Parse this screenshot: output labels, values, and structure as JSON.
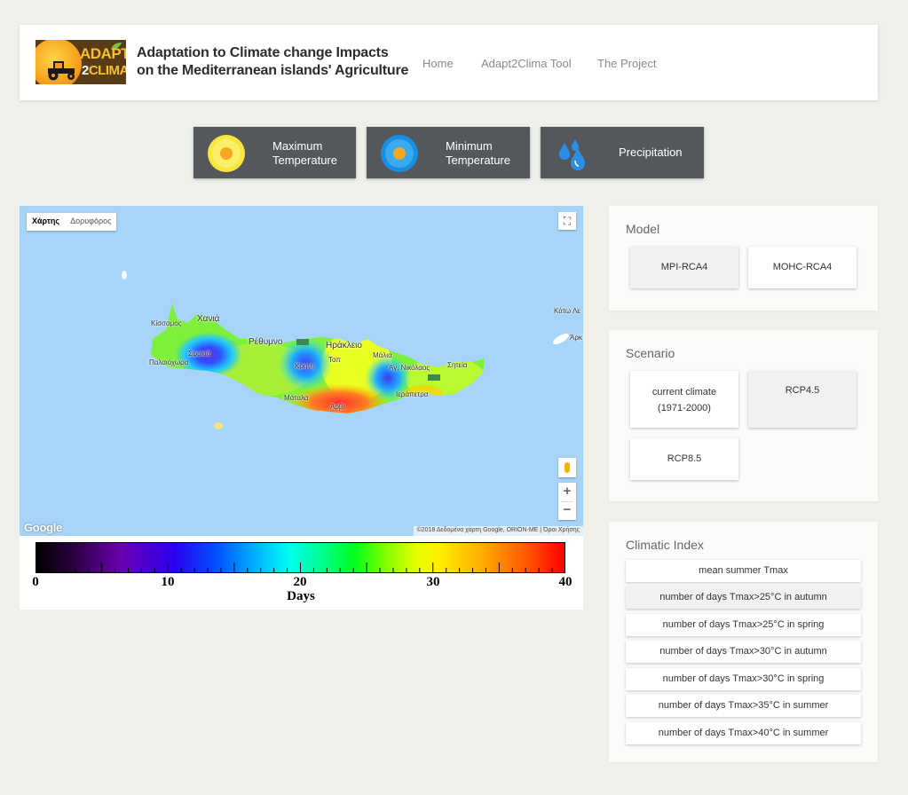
{
  "header": {
    "logo_text_1": "ADAPT",
    "logo_text_2a": "2",
    "logo_text_2b": "CLIMA",
    "title_line1": "Adaptation to Climate change Impacts",
    "title_line2": "on the Mediterranean islands' Agriculture",
    "nav": [
      "Home",
      "Adapt2Clima Tool",
      "The Project"
    ]
  },
  "variables": [
    {
      "line1": "Maximum",
      "line2": "Temperature",
      "icon": "sun-yellow-icon"
    },
    {
      "line1": "Minimum",
      "line2": "Temperature",
      "icon": "sun-blue-icon"
    },
    {
      "line1": "Precipitation",
      "icon": "raindrops-icon"
    }
  ],
  "map": {
    "map_type": [
      "Χάρτης",
      "Δορυφόρος"
    ],
    "selected_map_type": "Χάρτης",
    "places": {
      "chania": "Χανιά",
      "rethymno": "Ρέθυμνο",
      "heraklion": "Ηράκλειο",
      "kissamos": "Κίσσαμος",
      "sfakia": "Σφακιά",
      "paleochora": "Παλαιόχωρα",
      "kriti": "Κρήτη",
      "malia": "Μάλια",
      "agnikolaos": "Άγ. Νικόλαος",
      "siteia": "Σητεία",
      "ierapetra": "Ιεράπετρα",
      "matala": "Μάταλα",
      "arvi": "Άρβι",
      "kasos": "Κάτω Λε",
      "ark": "Άρκ",
      "tympaki": "Τοπ"
    },
    "google": "Google",
    "attribution": "©2018 Δεδομένα χάρτη Google, ORION-ME",
    "terms": "Όροι Χρήσης",
    "zoom_in": "+",
    "zoom_out": "−"
  },
  "legend": {
    "ticks": [
      "0",
      "10",
      "20",
      "30",
      "40"
    ],
    "unit": "Days",
    "range": [
      0,
      40
    ]
  },
  "model": {
    "title": "Model",
    "options": [
      "MPI-RCA4",
      "MOHC-RCA4"
    ],
    "selected": "MPI-RCA4"
  },
  "scenario": {
    "title": "Scenario",
    "option1_line1": "current climate",
    "option1_line2": "(1971-2000)",
    "option2": "RCP4.5",
    "option3": "RCP8.5",
    "selected": "RCP4.5"
  },
  "climatic_index": {
    "title": "Climatic Index",
    "options": [
      "mean summer Tmax",
      "number of days Tmax>25°C in autumn",
      "number of days Tmax>25°C in spring",
      "number of days Tmax>30°C in autumn",
      "number of days Tmax>30°C in spring",
      "number of days Tmax>35°C in summer",
      "number of days Tmax>40°C in summer"
    ],
    "selected": "number of days Tmax>25°C in autumn"
  },
  "colors": {
    "variable_button_bg": "#54585d",
    "selected_option_bg": "#f1f1f1",
    "sea": "#a7d5f8"
  }
}
